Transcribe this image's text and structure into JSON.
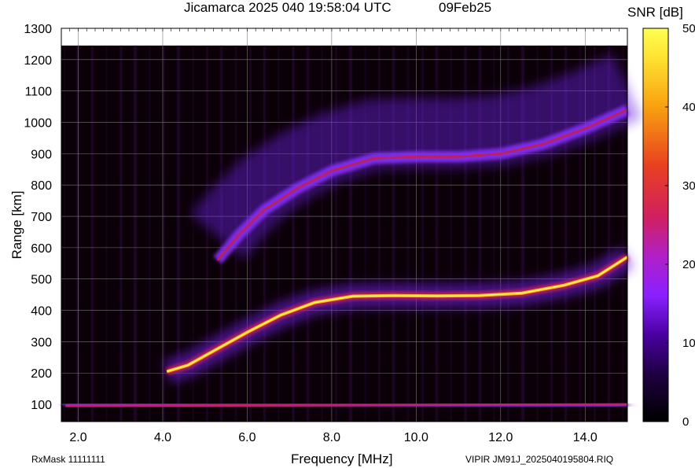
{
  "header": {
    "title": "Jicamarca 2025 040 19:58:04 UTC",
    "date": "09Feb25"
  },
  "footer": {
    "rxmask": "RxMask 11111111",
    "filename": "VIPIR  JM91J_2025040195804.RIQ"
  },
  "chart_data": {
    "type": "heatmap",
    "xlabel": "Frequency [MHz]",
    "ylabel": "Range [km]",
    "xlim": [
      1.6,
      15.0
    ],
    "ylim": [
      45,
      1300
    ],
    "x_ticks": [
      "2.0",
      "4.0",
      "6.0",
      "8.0",
      "10.0",
      "12.0",
      "14.0"
    ],
    "x_tick_values": [
      2,
      4,
      6,
      8,
      10,
      12,
      14
    ],
    "y_ticks": [
      "100",
      "200",
      "300",
      "400",
      "500",
      "600",
      "700",
      "800",
      "900",
      "1000",
      "1100",
      "1200",
      "1300"
    ],
    "y_tick_values": [
      100,
      200,
      300,
      400,
      500,
      600,
      700,
      800,
      900,
      1000,
      1100,
      1200,
      1300
    ],
    "grid": true,
    "colorbar": {
      "label": "SNR [dB]",
      "range": [
        0,
        50
      ],
      "ticks": [
        "0",
        "10",
        "20",
        "30",
        "40",
        "50"
      ],
      "tick_values": [
        0,
        10,
        20,
        30,
        40,
        50
      ],
      "colors": [
        "#000000",
        "#3a0070",
        "#7a10ff",
        "#b020c0",
        "#e03040",
        "#f07010",
        "#ffd020",
        "#ffff40"
      ]
    },
    "series": [
      {
        "trace": "first-hop",
        "points": [
          [
            4.1,
            205
          ],
          [
            4.6,
            225
          ],
          [
            5.2,
            270
          ],
          [
            6.0,
            330
          ],
          [
            6.8,
            385
          ],
          [
            7.6,
            425
          ],
          [
            8.5,
            445
          ],
          [
            9.5,
            447
          ],
          [
            10.5,
            446
          ],
          [
            11.5,
            447
          ],
          [
            12.5,
            455
          ],
          [
            13.5,
            480
          ],
          [
            14.3,
            510
          ],
          [
            15.0,
            570
          ]
        ],
        "snr_db": 40
      },
      {
        "trace": "second-hop",
        "points": [
          [
            5.3,
            560
          ],
          [
            5.8,
            640
          ],
          [
            6.4,
            720
          ],
          [
            7.2,
            790
          ],
          [
            8.0,
            845
          ],
          [
            9.0,
            885
          ],
          [
            10.0,
            890
          ],
          [
            11.0,
            890
          ],
          [
            12.0,
            900
          ],
          [
            13.0,
            930
          ],
          [
            14.0,
            980
          ],
          [
            15.0,
            1040
          ]
        ],
        "snr_db": 20
      },
      {
        "trace": "e-region",
        "points": [
          [
            1.7,
            95
          ],
          [
            15.0,
            100
          ]
        ],
        "snr_db": 22
      }
    ]
  }
}
